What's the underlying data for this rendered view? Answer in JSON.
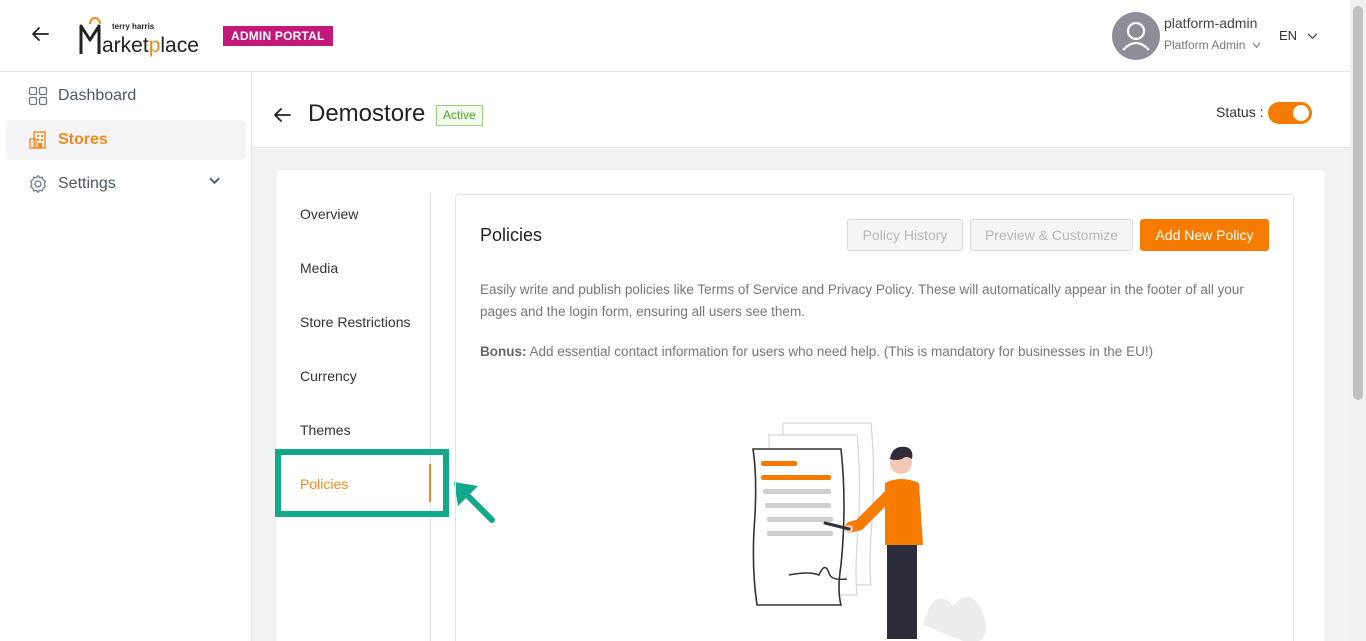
{
  "header": {
    "logo_alt": "terry harris Marketplace",
    "logo_small": "terry harris",
    "logo_main": "Marketplace",
    "portal_badge": "ADMIN PORTAL",
    "user_name": "platform-admin",
    "user_role": "Platform Admin",
    "language": "EN"
  },
  "sidebar": {
    "items": [
      {
        "label": "Dashboard"
      },
      {
        "label": "Stores"
      },
      {
        "label": "Settings"
      }
    ]
  },
  "page": {
    "store_name": "Demostore",
    "status_badge": "Active",
    "status_label": "Status :"
  },
  "tabs": [
    {
      "label": "Overview"
    },
    {
      "label": "Media"
    },
    {
      "label": "Store Restrictions"
    },
    {
      "label": "Currency"
    },
    {
      "label": "Themes"
    },
    {
      "label": "Policies"
    }
  ],
  "policies": {
    "title": "Policies",
    "history_button": "Policy History",
    "preview_button": "Preview & Customize",
    "add_button": "Add New Policy",
    "description": "Easily write and publish policies like Terms of Service and Privacy Policy. These will automatically appear in the footer of all your pages and the login form, ensuring all users see them.",
    "bonus_label": "Bonus:",
    "bonus_text": " Add essential contact information for users who need help. (This is mandatory for businesses in the EU!)"
  },
  "colors": {
    "accent": "#f28a1a",
    "primary_button": "#f57c00",
    "admin_badge": "#c2187a",
    "highlight": "#12a88a",
    "active_badge": "#4ea52c"
  }
}
